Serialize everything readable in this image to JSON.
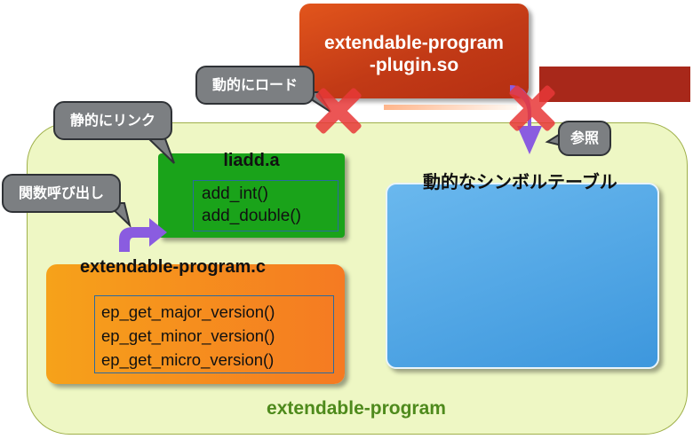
{
  "diagram": {
    "plugin_title_line1": "extendable-program",
    "plugin_title_line2": "-plugin.so",
    "liadd_title": "liadd.a",
    "liadd_functions": [
      "add_int()",
      "add_double()"
    ],
    "program_c_title": "extendable-program.c",
    "program_c_functions": [
      "ep_get_major_version()",
      "ep_get_minor_version()",
      "ep_get_micro_version()"
    ],
    "dynamic_symbol_table": "動的なシンボルテーブル",
    "program_label": "extendable-program",
    "callouts": {
      "dynamic_load": "動的にロード",
      "static_link": "静的にリンク",
      "function_call": "関数呼び出し",
      "reference": "参照"
    },
    "colors": {
      "program_bg": "#eef7c4",
      "plugin": "#c23a16",
      "library": "#1aa31a",
      "source": "#f57a22",
      "symbol_table": "#4aa3e4",
      "arrow": "#8a5ce0",
      "cross": "#e83838"
    }
  }
}
